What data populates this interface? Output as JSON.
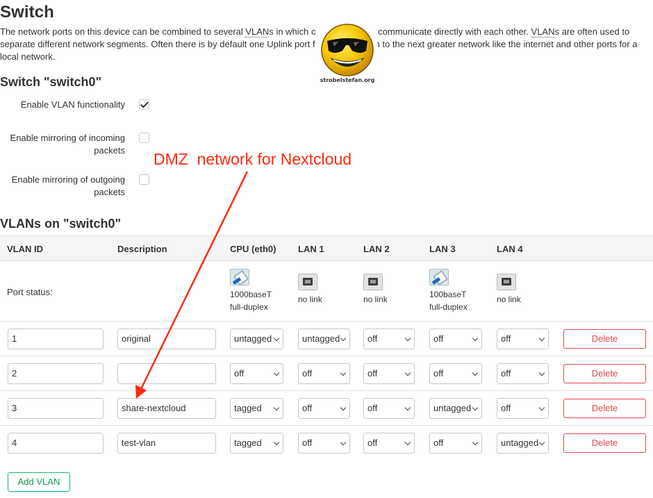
{
  "page": {
    "title": "Switch",
    "intro": [
      "The network ports on this device can be combined to several ",
      "VLAN",
      "s in which c",
      " communicate directly with each other. ",
      "VLAN",
      "s are often used to separate different network segments. Often there is by default one Uplink port f",
      "n to the next greater network like the internet and other ports for a local network."
    ]
  },
  "logo": {
    "text": "strobelstefan.org"
  },
  "switch_section": {
    "title": "Switch \"switch0\"",
    "options": [
      {
        "label": "Enable VLAN functionality",
        "checked": true
      },
      {
        "label": "Enable mirroring of incoming packets",
        "checked": false
      },
      {
        "label": "Enable mirroring of outgoing packets",
        "checked": false
      }
    ]
  },
  "annotation": {
    "text": "DMZ  network for Nextcloud",
    "color": "#ff2a0d"
  },
  "vlans_section": {
    "title": "VLANs on \"switch0\"",
    "columns": [
      "VLAN ID",
      "Description",
      "CPU (eth0)",
      "LAN 1",
      "LAN 2",
      "LAN 3",
      "LAN 4"
    ],
    "port_status_label": "Port status:",
    "ports": [
      {
        "state": "up",
        "line1": "1000baseT",
        "line2": "full-duplex"
      },
      {
        "state": "down",
        "line1": "no link",
        "line2": ""
      },
      {
        "state": "down",
        "line1": "no link",
        "line2": ""
      },
      {
        "state": "up",
        "line1": "100baseT",
        "line2": "full-duplex"
      },
      {
        "state": "down",
        "line1": "no link",
        "line2": ""
      }
    ],
    "rows": [
      {
        "id": "1",
        "description": "original",
        "ports": [
          "untagged",
          "untagged",
          "off",
          "off",
          "off"
        ]
      },
      {
        "id": "2",
        "description": "",
        "ports": [
          "off",
          "off",
          "off",
          "off",
          "off"
        ]
      },
      {
        "id": "3",
        "description": "share-nextcloud",
        "ports": [
          "tagged",
          "off",
          "off",
          "untagged",
          "off"
        ]
      },
      {
        "id": "4",
        "description": "test-vlan",
        "ports": [
          "tagged",
          "off",
          "off",
          "off",
          "untagged"
        ]
      }
    ],
    "delete_label": "Delete",
    "add_label": "Add VLAN"
  },
  "colors": {
    "delete": "#e5484d",
    "add": "#1bb56b",
    "annotation": "#ff2a0d"
  }
}
